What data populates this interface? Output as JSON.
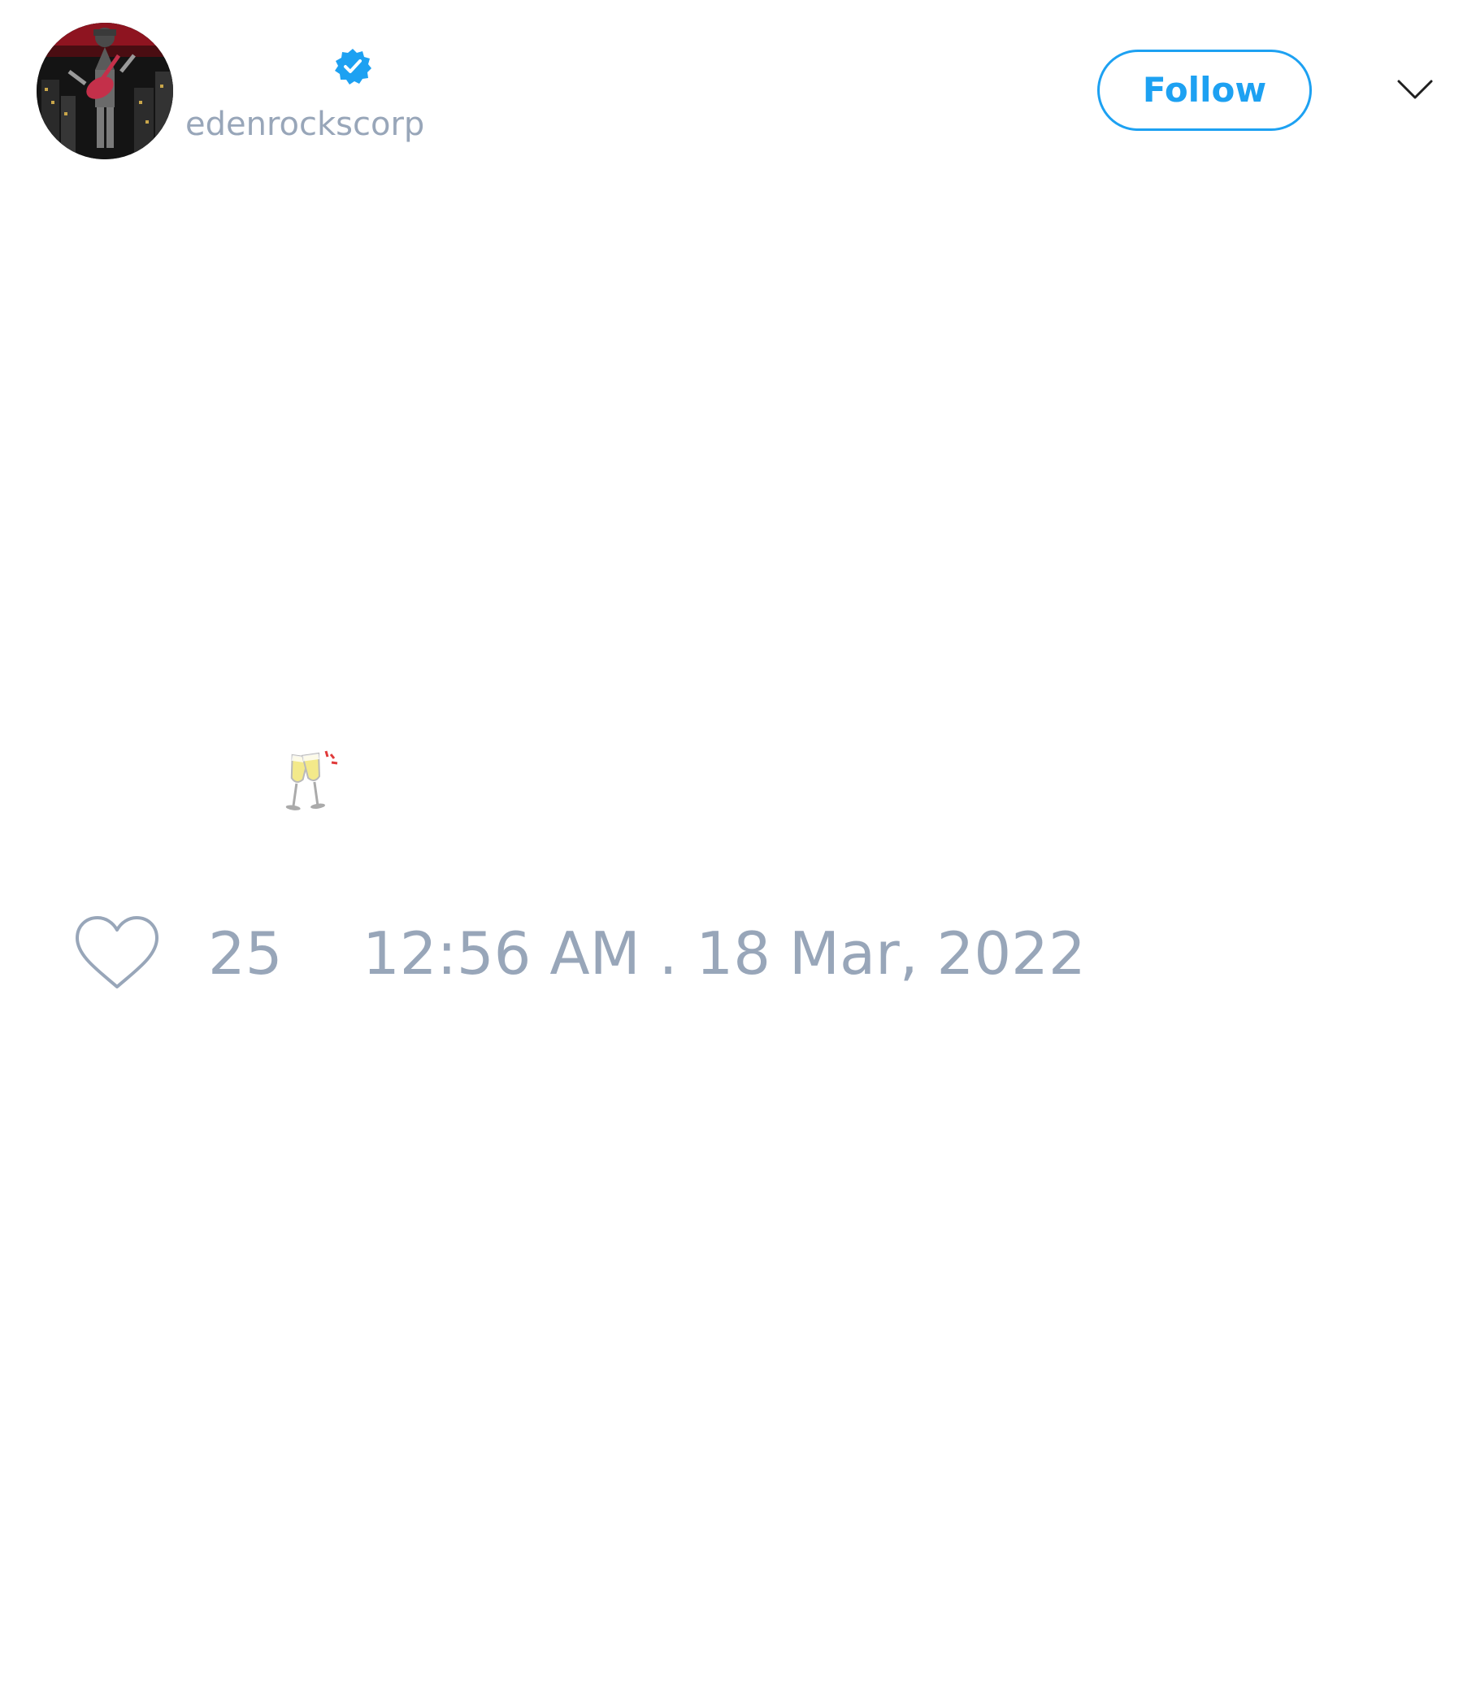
{
  "header": {
    "display_name": "",
    "handle": "edenrockscorp",
    "verified_icon": "verified-badge-icon",
    "follow_label": "Follow",
    "menu_icon": "chevron-down-icon"
  },
  "tweet": {
    "emoji_icon": "clinking-glasses-icon"
  },
  "footer": {
    "like_icon": "heart-icon",
    "like_count": "25",
    "timestamp": "12:56 AM . 18 Mar, 2022"
  },
  "colors": {
    "accent": "#1da1f2",
    "muted_text": "#98a6b9"
  }
}
